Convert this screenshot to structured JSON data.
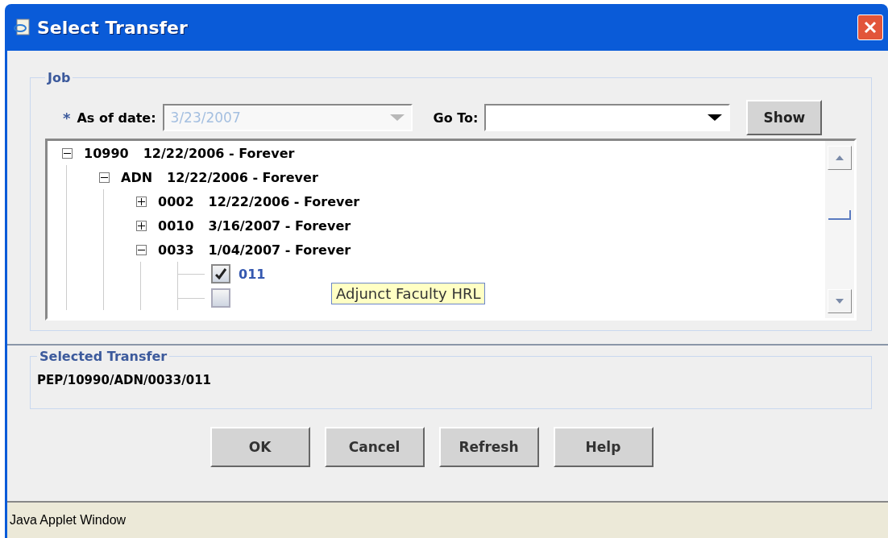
{
  "window": {
    "title": "Select Transfer"
  },
  "job": {
    "legend": "Job",
    "required_mark": "*",
    "as_of_label": "As of date:",
    "as_of_value": "3/23/2007",
    "as_of_disabled": true,
    "goto_label": "Go To:",
    "show_button": "Show"
  },
  "tree": [
    {
      "kind": "node",
      "label": "10990",
      "range": "12/22/2006 - Forever",
      "expanded": true,
      "children": [
        {
          "kind": "node",
          "label": "ADN",
          "range": "12/22/2006 - Forever",
          "expanded": true,
          "children": [
            {
              "kind": "node",
              "label": "0002",
              "range": "12/22/2006 - Forever",
              "expanded": false
            },
            {
              "kind": "node",
              "label": "0010",
              "range": "3/16/2007 - Forever",
              "expanded": false
            },
            {
              "kind": "node",
              "label": "0033",
              "range": "1/04/2007 - Forever",
              "expanded": true,
              "children": [
                {
                  "kind": "checkbox",
                  "label": "011",
                  "checked": true,
                  "selected": true
                },
                {
                  "kind": "checkbox",
                  "checked": false,
                  "selected": false
                }
              ]
            }
          ]
        }
      ]
    }
  ],
  "tooltip": "Adjunct Faculty HRL",
  "selected_transfer": {
    "legend": "Selected Transfer",
    "path": "PEP/10990/ADN/0033/011"
  },
  "buttons": [
    "OK",
    "Cancel",
    "Refresh",
    "Help"
  ],
  "status_bar": "Java Applet Window"
}
